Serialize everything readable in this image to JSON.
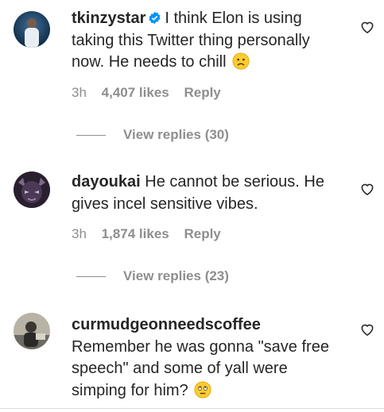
{
  "comments": [
    {
      "username": "tkinzystar",
      "verified": true,
      "text": "I think Elon is using taking this Twitter thing personally now. He needs to chill",
      "emoji": "sad-face-emoji",
      "time": "3h",
      "likes": "4,407 likes",
      "reply_label": "Reply",
      "view_replies": "View replies (30)"
    },
    {
      "username": "dayoukai",
      "verified": false,
      "text": "He cannot be serious. He gives incel sensitive vibes.",
      "time": "3h",
      "likes": "1,874 likes",
      "reply_label": "Reply",
      "view_replies": "View replies (23)"
    },
    {
      "username": "curmudgeonneedscoffee",
      "verified": false,
      "text": "Remember he was gonna \"save free speech\" and some of yall were simping for him?",
      "emoji": "eye-roll-emoji"
    }
  ],
  "icons": {
    "like": "heart-outline-icon",
    "verified": "verified-badge-icon"
  },
  "colors": {
    "text": "#262626",
    "secondary": "#8e8e8e",
    "verified": "#0095f6"
  }
}
